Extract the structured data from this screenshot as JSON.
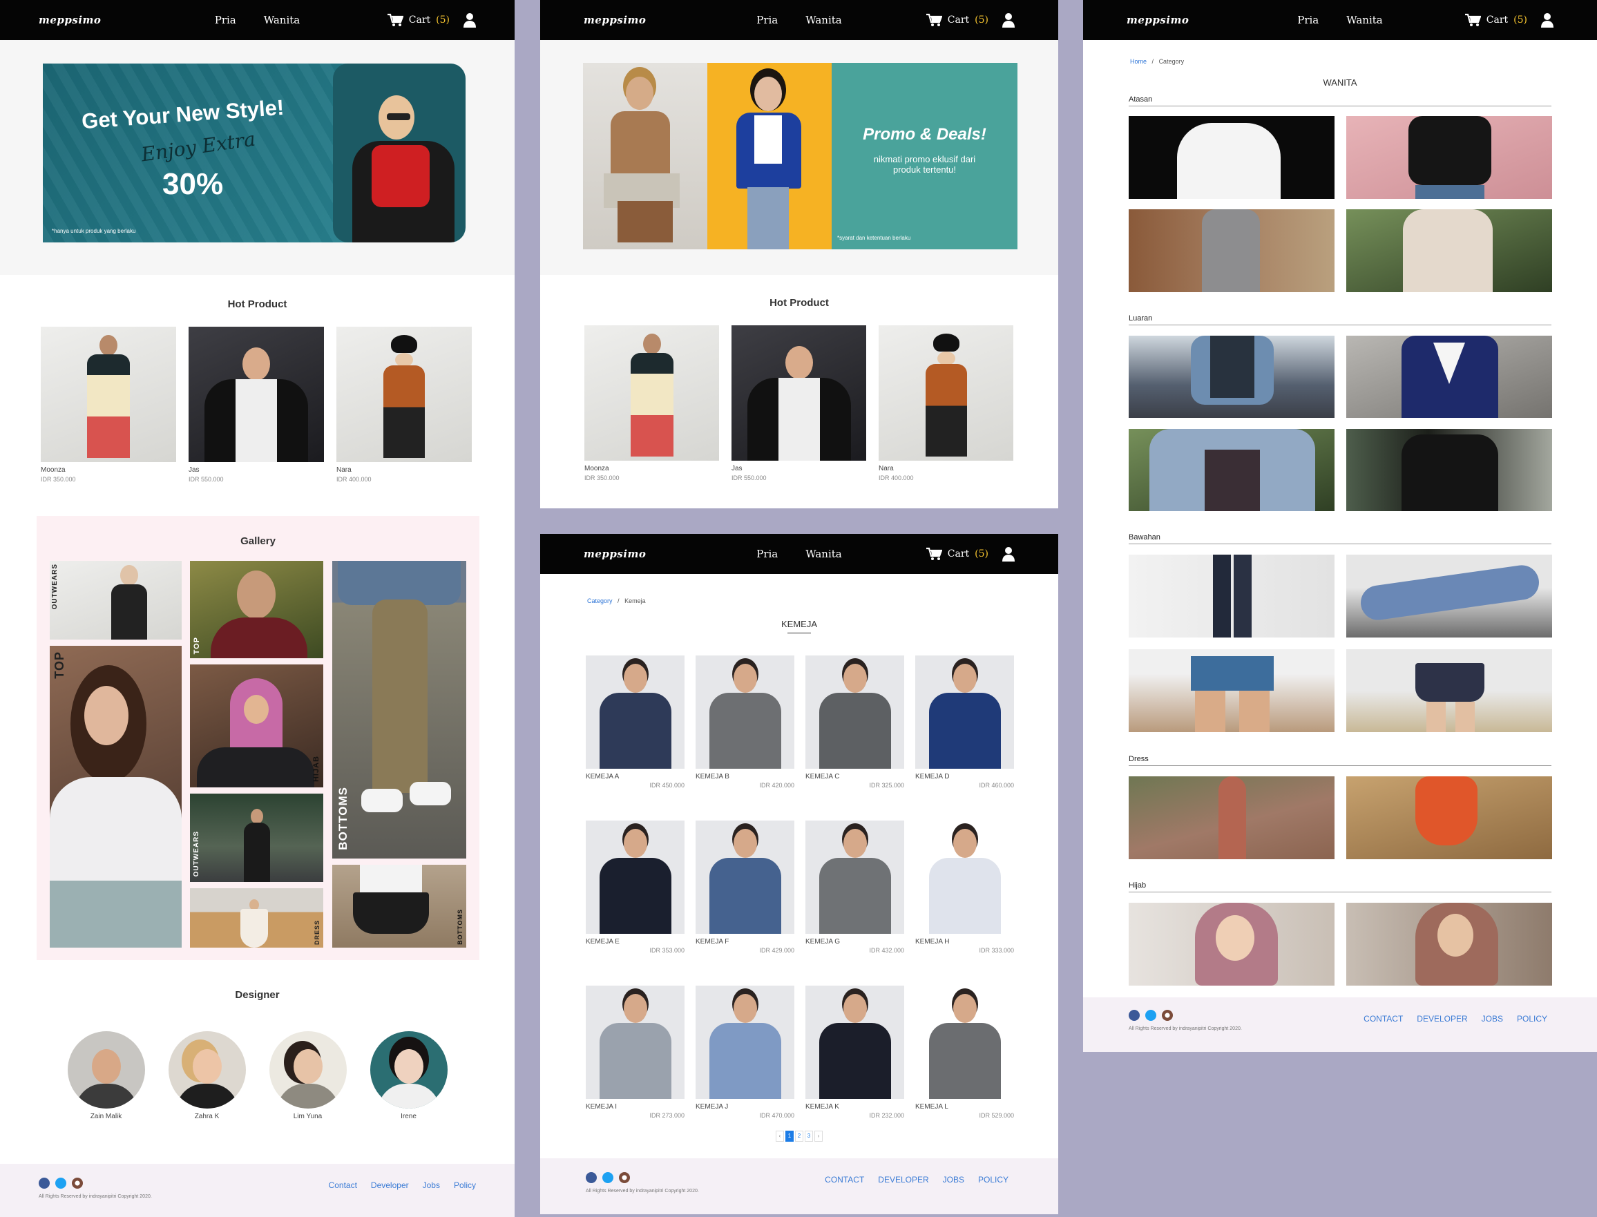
{
  "brand": "meppsimo",
  "nav": {
    "links": [
      "Pria",
      "Wanita"
    ],
    "cart_label": "Cart",
    "cart_count": "(5)"
  },
  "banner1": {
    "headline": "Get Your New Style!",
    "script": "Enjoy Extra",
    "percent": "30%",
    "note": "*hanya untuk produk yang berlaku"
  },
  "banner2": {
    "headline": "Promo & Deals!",
    "sub": "nikmati promo eklusif dari produk tertentu!",
    "note": "*syarat dan ketentuan berlaku"
  },
  "hot": {
    "title": "Hot Product",
    "items": [
      {
        "name": "Moonza",
        "price": "IDR 350.000"
      },
      {
        "name": "Jas",
        "price": "IDR 550.000"
      },
      {
        "name": "Nara",
        "price": "IDR 400.000"
      }
    ]
  },
  "gallery": {
    "title": "Gallery",
    "labels": {
      "outwears": "OUTWEARS",
      "top": "TOP",
      "hijab": "HIJAB",
      "bottoms": "BOTTOMS",
      "dress": "DRESS"
    }
  },
  "designer": {
    "title": "Designer",
    "people": [
      "Zain Malik",
      "Zahra K",
      "Lim Yuna",
      "Irene"
    ]
  },
  "footer": {
    "links1": [
      "Contact",
      "Developer",
      "Jobs",
      "Policy"
    ],
    "links2": [
      "CONTACT",
      "DEVELOPER",
      "JOBS",
      "POLICY"
    ],
    "copyright": "All Rights Reserved by indrayanipitri Copyright 2020."
  },
  "kemeja": {
    "crumb_link": "Category",
    "crumb_current": "Kemeja",
    "title": "KEMEJA",
    "items": [
      {
        "name": "KEMEJA A",
        "price": "IDR 450.000"
      },
      {
        "name": "KEMEJA B",
        "price": "IDR 420.000"
      },
      {
        "name": "KEMEJA C",
        "price": "IDR 325.000"
      },
      {
        "name": "KEMEJA D",
        "price": "IDR 460.000"
      },
      {
        "name": "KEMEJA E",
        "price": "IDR 353.000"
      },
      {
        "name": "KEMEJA F",
        "price": "IDR 429.000"
      },
      {
        "name": "KEMEJA G",
        "price": "IDR 432.000"
      },
      {
        "name": "KEMEJA H",
        "price": "IDR 333.000"
      },
      {
        "name": "KEMEJA I",
        "price": "IDR 273.000"
      },
      {
        "name": "KEMEJA J",
        "price": "IDR 470.000"
      },
      {
        "name": "KEMEJA K",
        "price": "IDR 232.000"
      },
      {
        "name": "KEMEJA L",
        "price": "IDR 529.000"
      }
    ],
    "pages": [
      "‹",
      "1",
      "2",
      "3",
      "›"
    ]
  },
  "wanita": {
    "crumb_link": "Home",
    "crumb_current": "Category",
    "title": "WANITA",
    "categories": [
      "Atasan",
      "Luaran",
      "Bawahan",
      "Dress",
      "Hijab"
    ]
  },
  "colors": {
    "nav_bg": "#050505",
    "cart_count": "#f2c12e",
    "banner_teal": "#1f6f7c",
    "promo_teal": "#4aa39b",
    "promo_yellow": "#f6b223",
    "link_blue": "#3a7bd5",
    "gallery_bg": "#fdf0f3",
    "footer_bg": "#f5f0f6",
    "page_active": "#1c7ce6"
  }
}
